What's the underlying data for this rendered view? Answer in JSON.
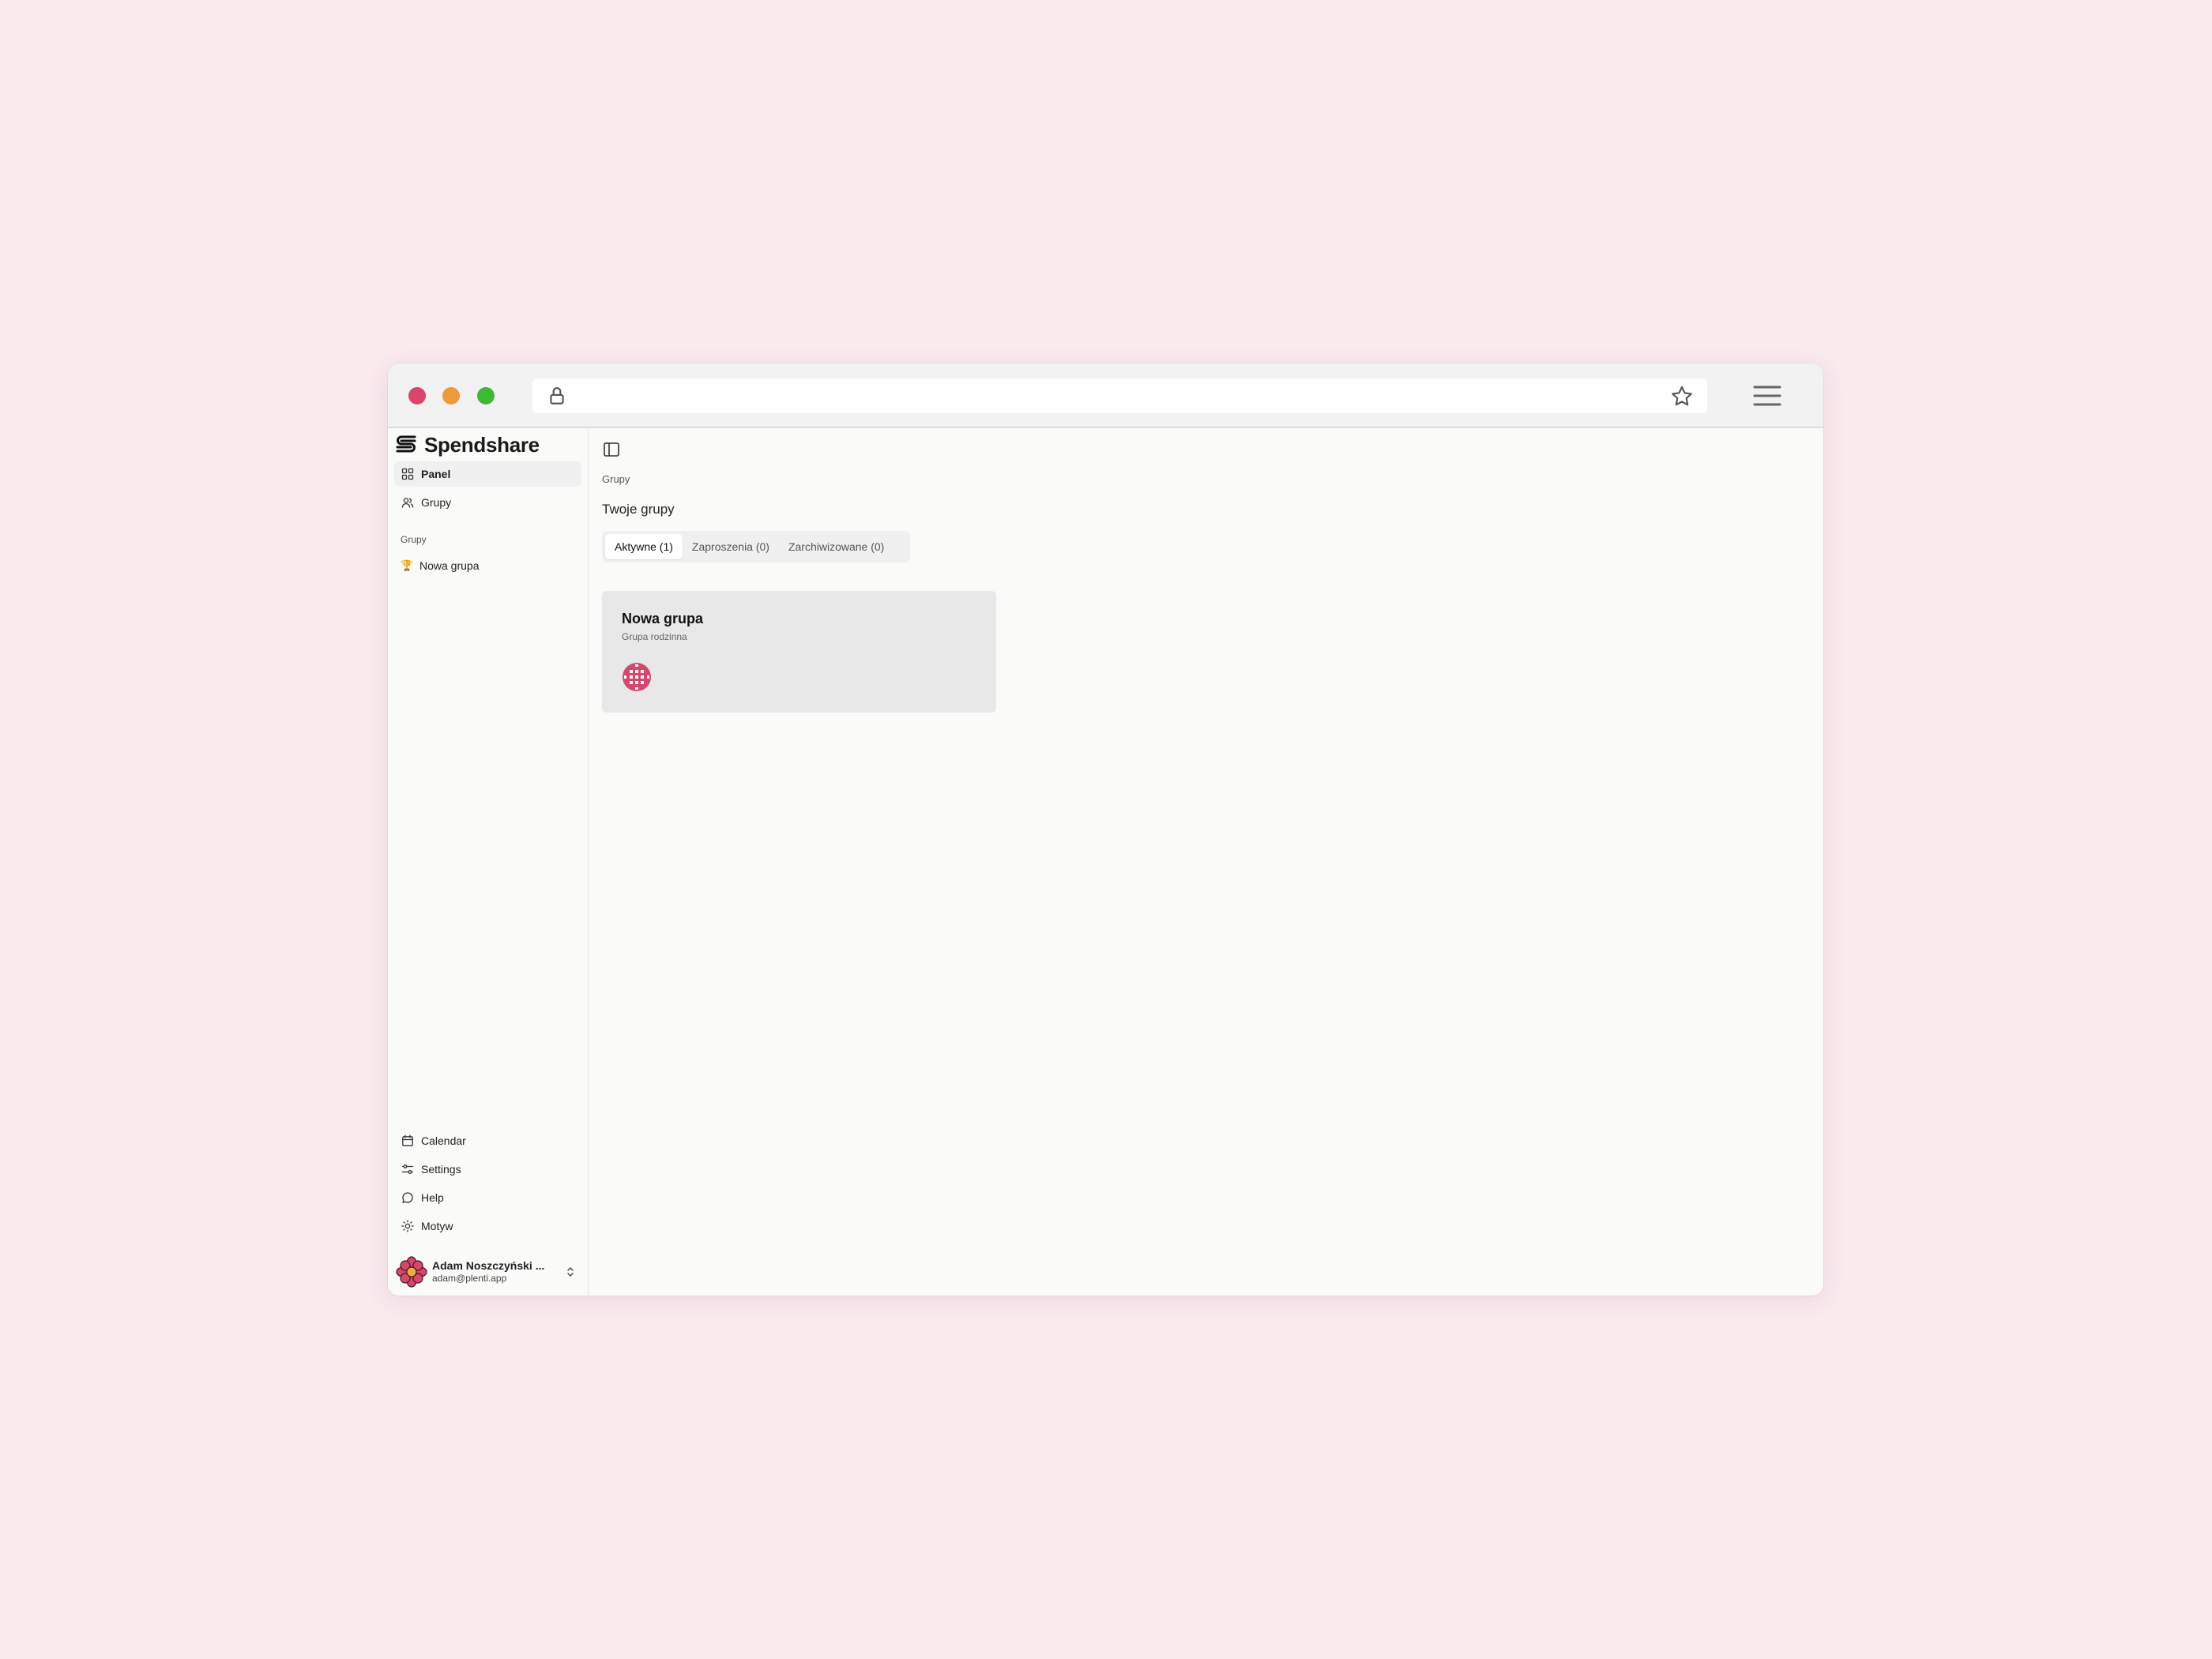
{
  "brand": {
    "name": "Spendshare"
  },
  "sidebar": {
    "nav": [
      {
        "label": "Panel",
        "icon": "grid-icon",
        "active": true
      },
      {
        "label": "Grupy",
        "icon": "users-icon",
        "active": false
      }
    ],
    "groups_section_label": "Grupy",
    "groups": [
      {
        "label": "Nowa grupa",
        "emoji": "🏆"
      }
    ],
    "bottom": [
      {
        "label": "Calendar",
        "icon": "calendar-icon"
      },
      {
        "label": "Settings",
        "icon": "sliders-icon"
      },
      {
        "label": "Help",
        "icon": "chat-bubble-icon"
      },
      {
        "label": "Motyw",
        "icon": "sun-icon"
      }
    ],
    "user": {
      "name": "Adam Noszczyński ...",
      "email": "adam@plenti.app"
    }
  },
  "main": {
    "breadcrumb": "Grupy",
    "heading": "Twoje grupy",
    "tabs": [
      {
        "label": "Aktywne (1)",
        "active": true
      },
      {
        "label": "Zaproszenia (0)",
        "active": false
      },
      {
        "label": "Zarchiwizowane (0)",
        "active": false
      }
    ],
    "cards": [
      {
        "title": "Nowa grupa",
        "subtitle": "Grupa rodzinna"
      }
    ]
  },
  "colors": {
    "background": "#faebef",
    "traffic_red": "#d9456b",
    "traffic_yellow": "#ec9a3a",
    "traffic_green": "#3dba33",
    "avatar_accent": "#d9456b"
  }
}
